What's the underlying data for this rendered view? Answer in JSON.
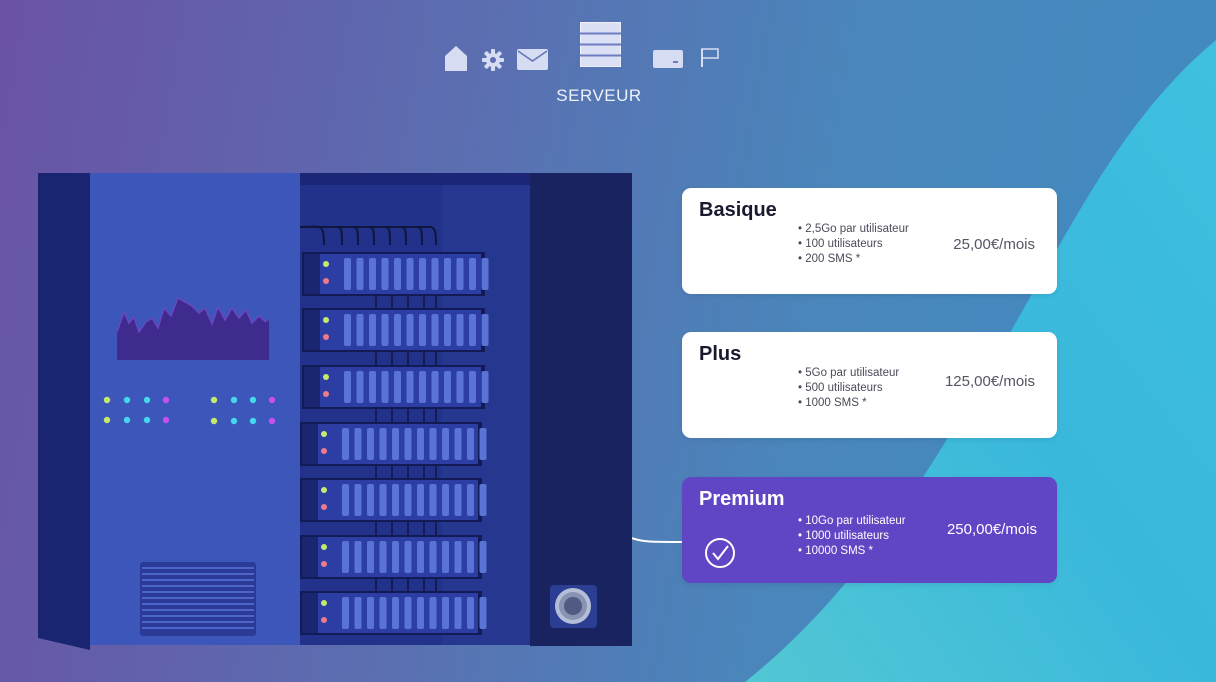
{
  "nav": {
    "icons": [
      "home-icon",
      "gear-icon",
      "mail-icon",
      "server-icon",
      "card-icon",
      "flag-icon"
    ],
    "active_label": "SERVEUR"
  },
  "plans": [
    {
      "name": "Basique",
      "features": [
        "2,5Go par utilisateur",
        "100 utilisateurs",
        "200 SMS *"
      ],
      "price": "25,00€/mois",
      "selected": false
    },
    {
      "name": "Plus",
      "features": [
        "5Go par utilisateur",
        "500 utilisateurs",
        "1000 SMS *"
      ],
      "price": "125,00€/mois",
      "selected": false
    },
    {
      "name": "Premium",
      "features": [
        "10Go par utilisateur",
        "1000 utilisateurs",
        "10000 SMS *"
      ],
      "price": "250,00€/mois",
      "selected": true
    }
  ],
  "colors": {
    "selected_card": "#6045c4",
    "card": "#ffffff",
    "server_body": "#1c2a78",
    "server_panel": "#3a55b8",
    "wave": "#3bb6dc"
  }
}
